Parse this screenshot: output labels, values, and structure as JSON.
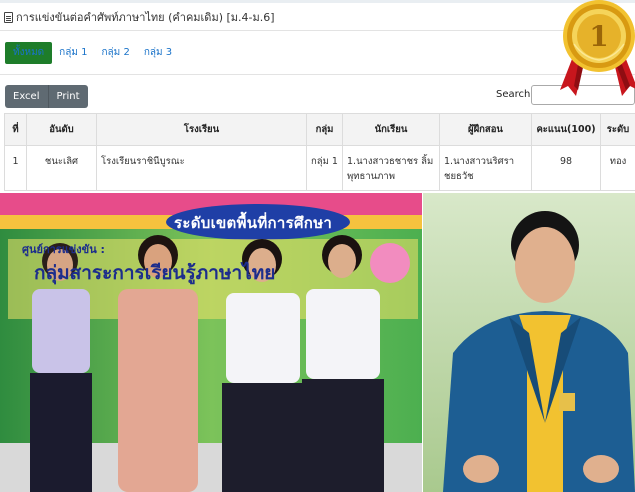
{
  "header": {
    "title": "การแข่งขันต่อคำศัพท์ภาษาไทย (คำคมเดิม) [ม.4-ม.6]"
  },
  "tabs": [
    {
      "label": "ทั้งหมด",
      "active": true
    },
    {
      "label": "กลุ่ม 1",
      "active": false
    },
    {
      "label": "กลุ่ม 2",
      "active": false
    },
    {
      "label": "กลุ่ม 3",
      "active": false
    }
  ],
  "toolbar": {
    "excel_label": "Excel",
    "print_label": "Print",
    "search_label": "Search:",
    "search_value": ""
  },
  "table": {
    "headers": [
      "ที่",
      "อันดับ",
      "โรงเรียน",
      "กลุ่ม",
      "นักเรียน",
      "ผู้ฝึกสอน",
      "คะแนน(100)",
      "ระดับ"
    ],
    "rows": [
      {
        "no": "1",
        "rank": "ชนะเลิศ",
        "school": "โรงเรียนราชินีบูรณะ",
        "group": "กลุ่ม 1",
        "student": "1.นางสาวธชาชร ลิ้มพุทธานภาพ",
        "coach": "1.นางสาวนริศรา ชยธวัช",
        "score": "98",
        "level": "ทอง"
      }
    ]
  },
  "medal": {
    "number": "1",
    "color_gold": "#e0a91c",
    "color_ribbon": "#c8161d"
  },
  "photo_banner": {
    "line1": "ระดับเขตพื้นที่การศึกษา",
    "line2": "ศูนย์การแข่งขัน :",
    "line3": "กลุ่มสาระการเรียนรู้ภาษาไทย"
  },
  "colors": {
    "active_tab_bg": "#1e7d2a",
    "link": "#1a73c9",
    "button_bg": "#5f6a72"
  }
}
